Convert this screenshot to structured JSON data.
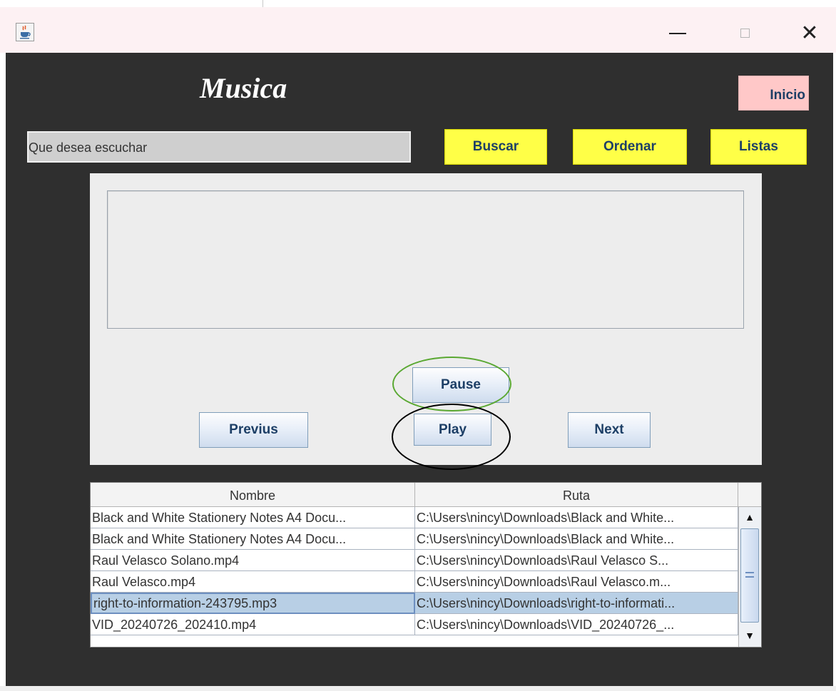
{
  "window": {
    "icon": "java-icon",
    "controls": {
      "minimize": "minimize-icon",
      "maximize": "maximize-icon",
      "close": "✕"
    }
  },
  "header": {
    "title": "Musica",
    "home_button": "Inicio"
  },
  "search": {
    "placeholder": "Que desea escuchar"
  },
  "toolbar": {
    "search_button": "Buscar",
    "sort_button": "Ordenar",
    "lists_button": "Listas"
  },
  "player": {
    "pause_label": "Pause",
    "previous_label": "Previus",
    "play_label": "Play",
    "next_label": "Next"
  },
  "table": {
    "columns": [
      "Nombre",
      "Ruta"
    ],
    "rows": [
      {
        "name": "Black and White Stationery Notes A4 Docu...",
        "path": "C:\\Users\\nincy\\Downloads\\Black and White..."
      },
      {
        "name": "Black and White Stationery Notes A4 Docu...",
        "path": "C:\\Users\\nincy\\Downloads\\Black and White..."
      },
      {
        "name": "Raul Velasco Solano.mp4",
        "path": "C:\\Users\\nincy\\Downloads\\Raul Velasco S..."
      },
      {
        "name": "Raul Velasco.mp4",
        "path": "C:\\Users\\nincy\\Downloads\\Raul Velasco.m..."
      },
      {
        "name": "right-to-information-243795.mp3",
        "path": "C:\\Users\\nincy\\Downloads\\right-to-informati..."
      },
      {
        "name": "VID_20240726_202410.mp4",
        "path": "C:\\Users\\nincy\\Downloads\\VID_20240726_..."
      }
    ],
    "selected_row": 4
  },
  "colors": {
    "frame_bg": "#2f2f2f",
    "accent_yellow": "#ffff47",
    "home_pink": "#ffc8c8",
    "annotation_green": "#5aa832",
    "annotation_black": "#000000"
  }
}
